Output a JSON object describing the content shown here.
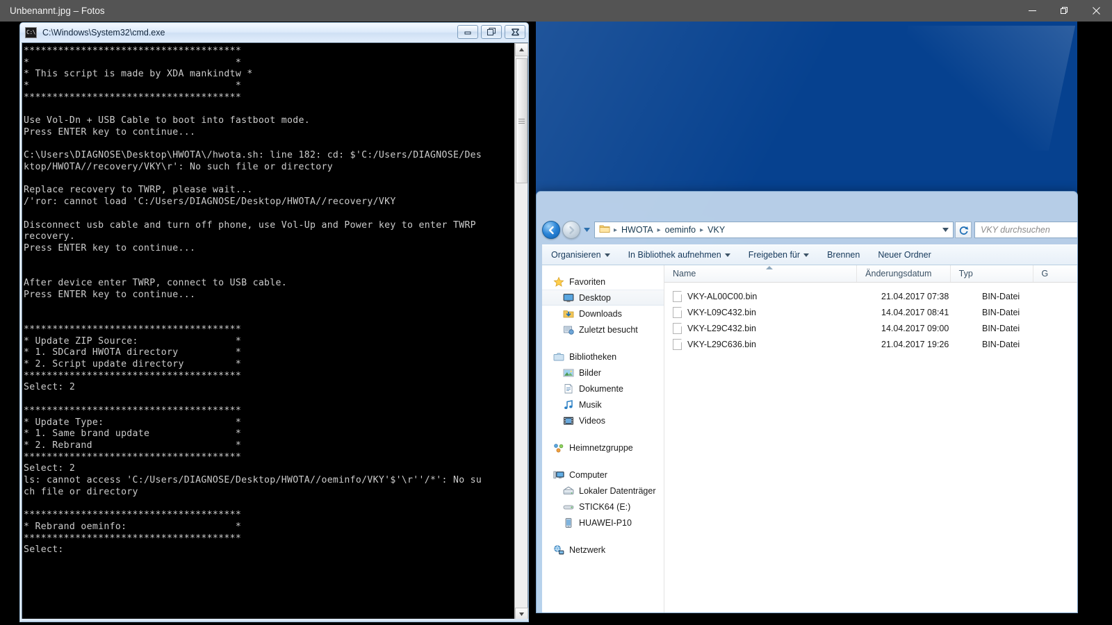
{
  "photos_app": {
    "title": "Unbenannt.jpg – Fotos",
    "window_buttons": [
      {
        "name": "minimize",
        "glyph": "minimize-icon"
      },
      {
        "name": "restore",
        "glyph": "restore-icon"
      },
      {
        "name": "close",
        "glyph": "close-icon"
      }
    ]
  },
  "cmd_window": {
    "title": "C:\\Windows\\System32\\cmd.exe",
    "icon_label": "C:\\",
    "buttons": {
      "minimize": "Minimieren",
      "maximize": "Maximieren",
      "close": "Schließen"
    },
    "console_text": "**************************************\n*                                    *\n* This script is made by XDA mankindtw *\n*                                    *\n**************************************\n\nUse Vol-Dn + USB Cable to boot into fastboot mode.\nPress ENTER key to continue...\n\nC:\\Users\\DIAGNOSE\\Desktop\\HWOTA\\/hwota.sh: line 182: cd: $'C:/Users/DIAGNOSE/Des\nktop/HWOTA//recovery/VKY\\r': No such file or directory\n\nReplace recovery to TWRP, please wait...\n/'ror: cannot load 'C:/Users/DIAGNOSE/Desktop/HWOTA//recovery/VKY\n\nDisconnect usb cable and turn off phone, use Vol-Up and Power key to enter TWRP\nrecovery.\nPress ENTER key to continue...\n\n\nAfter device enter TWRP, connect to USB cable.\nPress ENTER key to continue...\n\n\n**************************************\n* Update ZIP Source:                 *\n* 1. SDCard HWOTA directory          *\n* 2. Script update directory         *\n**************************************\nSelect: 2\n\n**************************************\n* Update Type:                       *\n* 1. Same brand update               *\n* 2. Rebrand                         *\n**************************************\nSelect: 2\nls: cannot access 'C:/Users/DIAGNOSE/Desktop/HWOTA//oeminfo/VKY'$'\\r''/*': No su\nch file or directory\n\n**************************************\n* Rebrand oeminfo:                   *\n**************************************\nSelect:"
  },
  "explorer": {
    "nav_buttons": {
      "back": "Zurück",
      "forward": "Vorwärts",
      "history": "Letzte Seiten"
    },
    "breadcrumbs": [
      "HWOTA",
      "oeminfo",
      "VKY"
    ],
    "address_dropdown": "chevron-down-icon",
    "refresh": "refresh-icon",
    "search": {
      "placeholder": "VKY durchsuchen"
    },
    "toolbar": [
      {
        "label": "Organisieren",
        "caret": true
      },
      {
        "label": "In Bibliothek aufnehmen",
        "caret": true
      },
      {
        "label": "Freigeben für",
        "caret": true
      },
      {
        "label": "Brennen",
        "caret": false
      },
      {
        "label": "Neuer Ordner",
        "caret": false
      }
    ],
    "nav_pane": [
      {
        "label": "Favoriten",
        "icon": "star-icon",
        "level": "root",
        "selected": false
      },
      {
        "label": "Desktop",
        "icon": "desktop-icon",
        "level": "child",
        "selected": true
      },
      {
        "label": "Downloads",
        "icon": "downloads-icon",
        "level": "child",
        "selected": false
      },
      {
        "label": "Zuletzt besucht",
        "icon": "recent-places-icon",
        "level": "child",
        "selected": false
      },
      {
        "label": "Bibliotheken",
        "icon": "libraries-icon",
        "level": "root",
        "selected": false
      },
      {
        "label": "Bilder",
        "icon": "pictures-icon",
        "level": "child",
        "selected": false
      },
      {
        "label": "Dokumente",
        "icon": "documents-icon",
        "level": "child",
        "selected": false
      },
      {
        "label": "Musik",
        "icon": "music-icon",
        "level": "child",
        "selected": false
      },
      {
        "label": "Videos",
        "icon": "videos-icon",
        "level": "child",
        "selected": false
      },
      {
        "label": "Heimnetzgruppe",
        "icon": "homegroup-icon",
        "level": "root",
        "selected": false
      },
      {
        "label": "Computer",
        "icon": "computer-icon",
        "level": "root",
        "selected": false
      },
      {
        "label": "Lokaler Datenträger",
        "icon": "harddisk-icon",
        "level": "child",
        "selected": false
      },
      {
        "label": "STICK64 (E:)",
        "icon": "usb-drive-icon",
        "level": "child",
        "selected": false
      },
      {
        "label": "HUAWEI-P10",
        "icon": "phone-icon",
        "level": "child",
        "selected": false
      },
      {
        "label": "Netzwerk",
        "icon": "network-icon",
        "level": "root",
        "selected": false
      }
    ],
    "columns": [
      "Name",
      "Änderungsdatum",
      "Typ",
      "G"
    ],
    "sort_column": "Name",
    "files": [
      {
        "name": "VKY-AL00C00.bin",
        "date": "21.04.2017 07:38",
        "type": "BIN-Datei"
      },
      {
        "name": "VKY-L09C432.bin",
        "date": "14.04.2017 08:41",
        "type": "BIN-Datei"
      },
      {
        "name": "VKY-L29C432.bin",
        "date": "14.04.2017 09:00",
        "type": "BIN-Datei"
      },
      {
        "name": "VKY-L29C636.bin",
        "date": "21.04.2017 19:26",
        "type": "BIN-Datei"
      }
    ]
  },
  "colors": {
    "photos_titlebar": "#545454",
    "console_bg": "#000000",
    "console_fg": "#cccccc",
    "desktop_blue": "#0a54ab",
    "aero_frame": "#c4d8ee"
  }
}
